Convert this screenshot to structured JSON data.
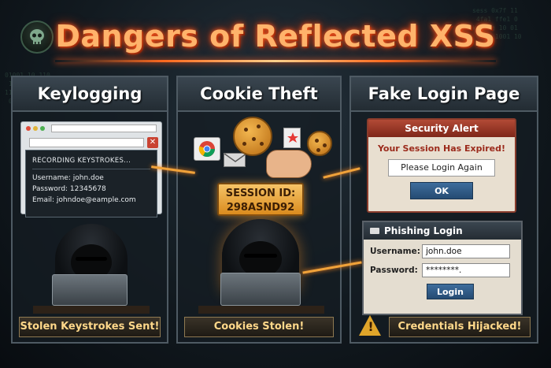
{
  "title": "Dangers of Reflected XSS",
  "colors": {
    "accent": "#ff6a1f",
    "gold": "#ffd88a",
    "panel_border": "#4e5a63",
    "alert_red": "#9b2a1b"
  },
  "icons": [
    "skull-icon",
    "chrome-icon",
    "envelope-icon",
    "cookie-icon",
    "hand-icon",
    "warning-icon",
    "arrow-icon"
  ],
  "panels": [
    {
      "heading": "Keylogging",
      "recording": "RECORDING KEYSTROKES...",
      "username_line": "Username:  john.doe",
      "password_line": "Password:  12345678",
      "email_line": "Email:  johndoe@eample.com",
      "caption": "Stolen Keystrokes Sent!"
    },
    {
      "heading": "Cookie Theft",
      "session_label": "SESSION ID:",
      "session_value": "298ASND92",
      "caption": "Cookies Stolen!"
    },
    {
      "heading": "Fake Login Page",
      "alert_title": "Security Alert",
      "alert_message": "Your Session Has Expired!",
      "alert_button": "Please Login Again",
      "alert_ok": "OK",
      "phish_title": "Phishing Login",
      "username_label": "Username:",
      "username_value": "john.doe",
      "password_label": "Password:",
      "password_value": "********.",
      "login_button": "Login",
      "caption": "Credentials Hijacked!"
    }
  ]
}
